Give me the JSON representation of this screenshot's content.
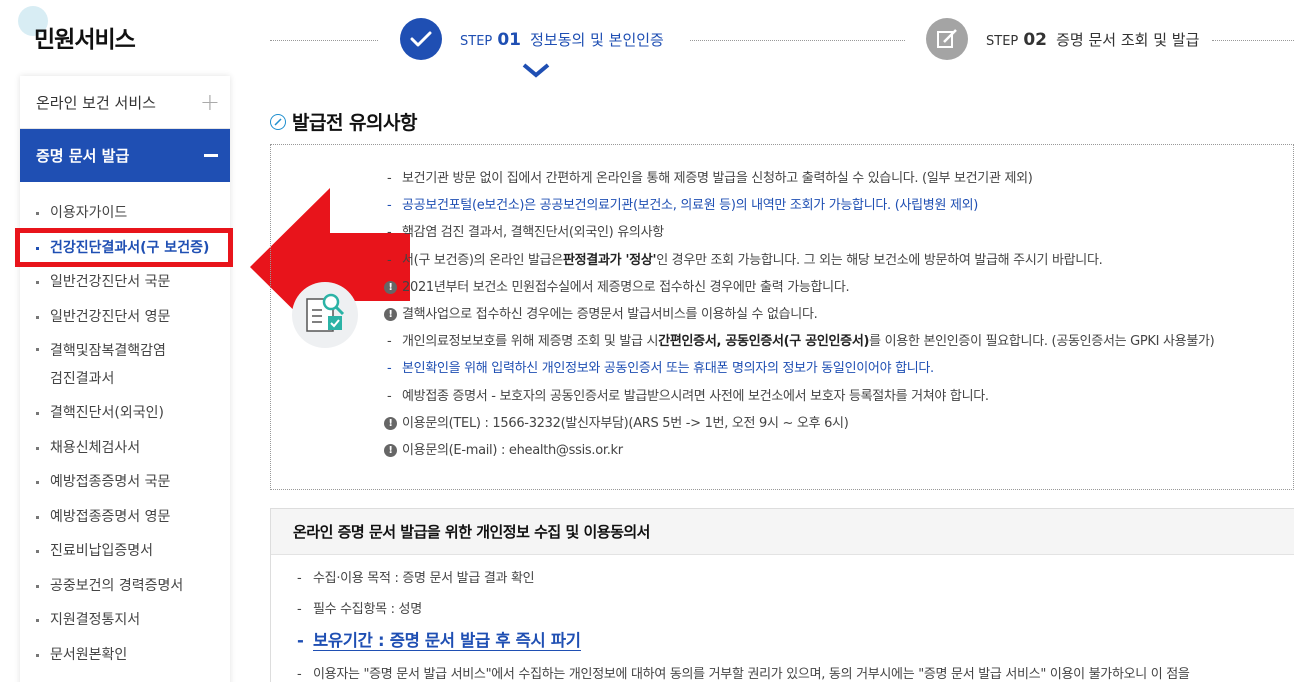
{
  "sidebar": {
    "title": "민원서비스",
    "online_label": "온라인 보건 서비스",
    "active_label": "증명 문서 발급",
    "items": [
      "이용자가이드",
      "건강진단결과서(구 보건증)",
      "일반건강진단서 국문",
      "일반건강진단서 영문",
      "결핵및잠복결핵감염",
      "검진결과서",
      "결핵진단서(외국인)",
      "채용신체검사서",
      "예방접종증명서 국문",
      "예방접종증명서 영문",
      "진료비납입증명서",
      "공중보건의 경력증명서",
      "지원결정통지서",
      "문서원본확인"
    ]
  },
  "steps": {
    "step1_prefix": "STEP",
    "step1_num": "01",
    "step1_text": "정보동의 및 본인인증",
    "step2_prefix": "STEP",
    "step2_num": "02",
    "step2_text": "증명 문서 조회 및 발급"
  },
  "notice": {
    "title": "발급전 유의사항",
    "l1": "보건기관 방문 없이 집에서 간편하게 온라인을 통해 제증명 발급을 신청하고 출력하실 수 있습니다. (일부 보건기관 제외)",
    "l2": "공공보건포털(e보건소)은 공공보건의료기관(보건소, 의료원 등)의 내역만 조회가 가능합니다. (사립병원 제외)",
    "l3": "핵감염 검진 결과서, 결핵진단서(외국인) 유의사항",
    "l4a": "서(구 보건증)의 온라인 발급은 ",
    "l4b": "판정결과가 '정상'",
    "l4c": "인 경우만 조회 가능합니다. 그 외는 해당 보건소에 방문하여 발급해 주시기 바랍니다.",
    "l5": "2021년부터 보건소 민원접수실에서 제증명으로 접수하신 경우에만 출력 가능합니다.",
    "l6": "결핵사업으로 접수하신 경우에는 증명문서 발급서비스를 이용하실 수 없습니다.",
    "l7a": "개인의료정보보호를 위해 제증명 조회 및 발급 시 ",
    "l7b": "간편인증서, 공동인증서(구 공인인증서)",
    "l7c": "를 이용한 본인인증이 필요합니다. (공동인증서는 GPKI 사용불가)",
    "l8": "본인확인을 위해 입력하신 개인정보와 공동인증서 또는 휴대폰 명의자의 정보가 동일인이어야 합니다.",
    "l9": "예방접종 증명서 - 보호자의 공동인증서로 발급받으시려면 사전에 보건소에서 보호자 등록절차를 거쳐야 합니다.",
    "l10": "이용문의(TEL) : 1566-3232(발신자부담)(ARS 5번 -> 1번, 오전 9시 ~ 오후 6시)",
    "l11": "이용문의(E-mail) : ehealth@ssis.or.kr"
  },
  "consent": {
    "title": "온라인 증명 문서 발급을 위한 개인정보 수집 및 이용동의서",
    "c1": "수집·이용 목적 : 증명 문서 발급 결과 확인",
    "c2": "필수 수집항목 : 성명",
    "c3": "보유기간 : 증명 문서 발급 후 즉시 파기",
    "c4": "이용자는 \"증명 문서 발급 서비스\"에서 수집하는 개인정보에 대하여 동의를 거부할 권리가 있으며, 동의 거부시에는 \"증명 문서 발급 서비스\" 이용이 불가하오니 이 점을"
  },
  "colors": {
    "primary": "#1f4fb3",
    "highlight": "#e8141b",
    "step_inactive": "#a4a4a4"
  }
}
